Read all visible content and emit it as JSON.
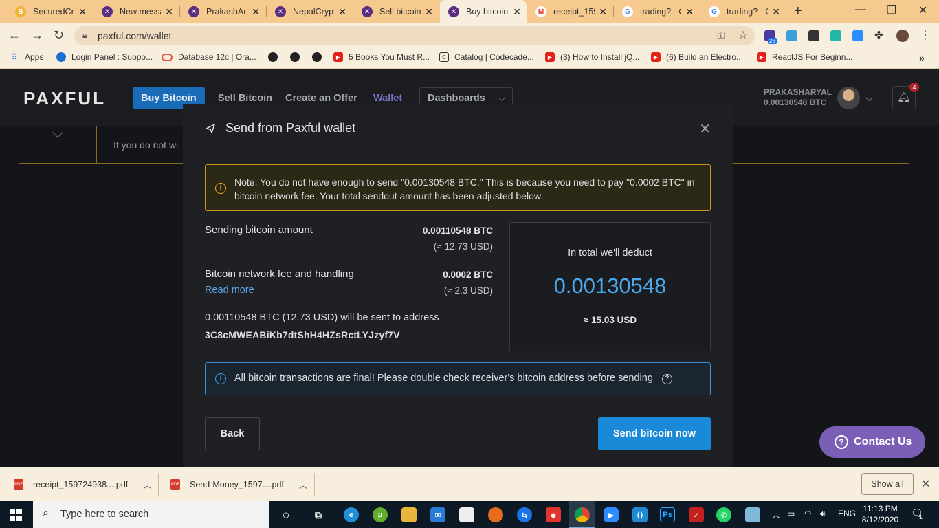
{
  "browser": {
    "tabs": [
      {
        "label": "SecuredCry",
        "color": "#f2b233"
      },
      {
        "label": "New messa",
        "color": "#5a2d82"
      },
      {
        "label": "PrakashAry",
        "color": "#5a2d82"
      },
      {
        "label": "NepalCrypt",
        "color": "#5a2d82"
      },
      {
        "label": "Sell bitcoin",
        "color": "#5a2d82"
      },
      {
        "label": "Buy bitcoin",
        "color": "#5a2d82"
      },
      {
        "label": "receipt_159",
        "color": "#d93025"
      },
      {
        "label": "trading? - C",
        "color": "#4285f4"
      },
      {
        "label": "trading? - C",
        "color": "#4285f4"
      }
    ],
    "url": "paxful.com/wallet",
    "extension_badge": "23",
    "bookmarks": [
      {
        "label": "Apps"
      },
      {
        "label": "Login Panel : Suppo..."
      },
      {
        "label": "Database 12c | Ora..."
      },
      {
        "label": ""
      },
      {
        "label": ""
      },
      {
        "label": ""
      },
      {
        "label": "5 Books You Must R..."
      },
      {
        "label": "Catalog | Codecade..."
      },
      {
        "label": "(3) How to Install jQ..."
      },
      {
        "label": "(6) Build an Electro..."
      },
      {
        "label": "ReactJS For Beginn..."
      }
    ]
  },
  "site": {
    "logo": "PAXFUL",
    "nav": {
      "buy": "Buy Bitcoin",
      "sell": "Sell Bitcoin",
      "create": "Create an Offer",
      "wallet": "Wallet",
      "dashboards": "Dashboards"
    },
    "user": {
      "name": "PRAKASHARYAL",
      "balance": "0.00130548 BTC",
      "notifications": "4"
    },
    "banner_text": "If you do not wi"
  },
  "modal": {
    "title": "Send from Paxful wallet",
    "note": "Note: You do not have enough to send \"0.00130548 BTC.\" This is because you need to pay \"0.0002 BTC\" in bitcoin network fee. Your total sendout amount has been adjusted below.",
    "sending_label": "Sending bitcoin amount",
    "sending_btc": "0.00110548 BTC",
    "sending_usd": "(≈ 12.73 USD)",
    "fee_label": "Bitcoin network fee and handling",
    "fee_btc": "0.0002 BTC",
    "fee_usd": "(≈ 2.3 USD)",
    "read_more": "Read more",
    "sent_line": "0.00110548 BTC (12.73 USD) will be sent to address",
    "address": "3C8cMWEABiKb7dtShH4HZsRctLYJzyf7V",
    "total_label": "In total we'll deduct",
    "total_value": "0.00130548",
    "total_usd": "≈ 15.03 USD",
    "info": "All bitcoin transactions are final! Please double check receiver's bitcoin address before sending",
    "back": "Back",
    "send": "Send bitcoin now"
  },
  "contact": "Contact Us",
  "downloads": {
    "items": [
      "receipt_159724938....pdf",
      "Send-Money_1597....pdf"
    ],
    "show_all": "Show all"
  },
  "taskbar": {
    "search": "Type here to search",
    "lang": "ENG",
    "time": "11:13 PM",
    "date": "8/12/2020",
    "notif_count": "1"
  }
}
